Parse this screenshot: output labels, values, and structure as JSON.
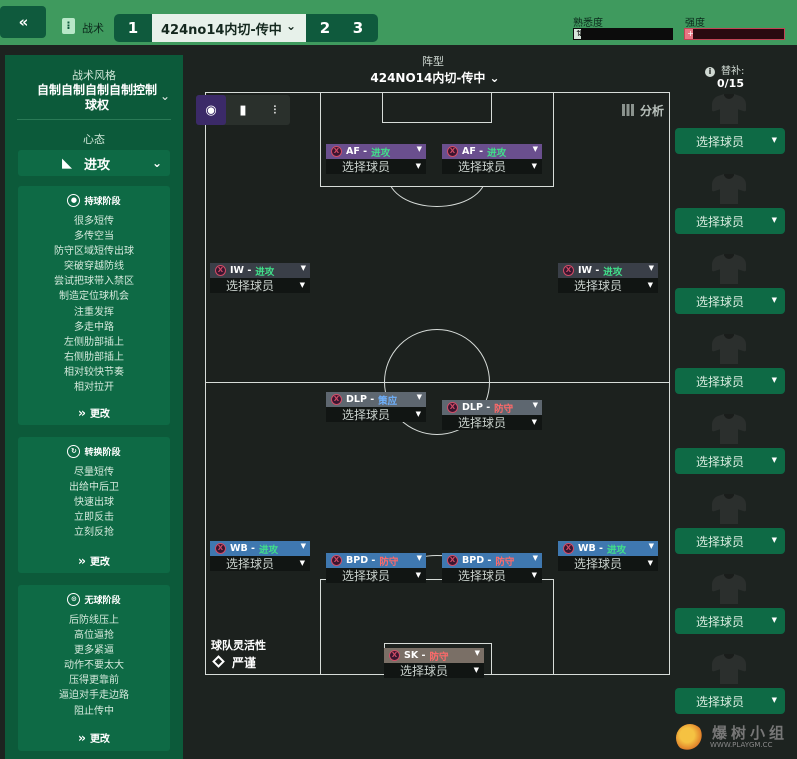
{
  "topbar": {
    "collapse_icon": "«",
    "tab_icon": "tactics-board-icon",
    "tab_label": "战术",
    "slots": [
      "1",
      "2",
      "3"
    ],
    "active_tactic": "424no14内切-传中",
    "familiarity_label": "熟悉度",
    "familiarity_level": 0.07,
    "intensity_label": "强度",
    "intensity_level": 0.08,
    "colors": {
      "bar": "#3f9a5e",
      "dark": "#0f5a3d",
      "intensity_fill": "#e05a6a"
    }
  },
  "left_panel": {
    "style_title": "战术风格",
    "style_value": "自制自制自制自制控制球权",
    "mentality_title": "心态",
    "mentality_value": "进攻",
    "phases": [
      {
        "title": "持球阶段",
        "icon": "ball-icon",
        "items": [
          "很多短传",
          "多传空当",
          "防守区域短传出球",
          "突破穿越防线",
          "尝试把球带入禁区",
          "制造定位球机会",
          "注重发挥",
          "多走中路",
          "左侧肋部插上",
          "右侧肋部插上",
          "相对较快节奏",
          "相对拉开"
        ],
        "change_label": "更改"
      },
      {
        "title": "转换阶段",
        "icon": "transition-icon",
        "items": [
          "尽量短传",
          "出给中后卫",
          "快速出球",
          "立即反击",
          "立刻反抢"
        ],
        "change_label": "更改"
      },
      {
        "title": "无球阶段",
        "icon": "defend-icon",
        "items": [
          "后防线压上",
          "高位逼抢",
          "更多紧逼",
          "动作不要太大",
          "压得更靠前",
          "逼迫对手走边路",
          "阻止传中"
        ],
        "change_label": "更改"
      }
    ]
  },
  "formation": {
    "label": "阵型",
    "name": "424NO14内切-传中",
    "analysis_label": "分析",
    "flexibility_label": "球队灵活性",
    "flexibility_value": "严谨"
  },
  "positions": [
    {
      "role": "AF",
      "duty": "进攻",
      "duty_type": "attack",
      "player": "选择球员",
      "color": "#6a4f8e"
    },
    {
      "role": "AF",
      "duty": "进攻",
      "duty_type": "attack",
      "player": "选择球员",
      "color": "#6a4f8e"
    },
    {
      "role": "IW",
      "duty": "进攻",
      "duty_type": "attack",
      "player": "选择球员",
      "color": "#3a3f48"
    },
    {
      "role": "IW",
      "duty": "进攻",
      "duty_type": "attack",
      "player": "选择球员",
      "color": "#3a3f48"
    },
    {
      "role": "DLP",
      "duty": "策应",
      "duty_type": "support",
      "player": "选择球员",
      "color": "#5e6770"
    },
    {
      "role": "DLP",
      "duty": "防守",
      "duty_type": "defend",
      "player": "选择球员",
      "color": "#5e6770"
    },
    {
      "role": "WB",
      "duty": "进攻",
      "duty_type": "attack",
      "player": "选择球员",
      "color": "#3f78b0"
    },
    {
      "role": "BPD",
      "duty": "防守",
      "duty_type": "defend",
      "player": "选择球员",
      "color": "#3f78b0"
    },
    {
      "role": "BPD",
      "duty": "防守",
      "duty_type": "defend",
      "player": "选择球员",
      "color": "#3f78b0"
    },
    {
      "role": "WB",
      "duty": "进攻",
      "duty_type": "attack",
      "player": "选择球员",
      "color": "#3f78b0"
    },
    {
      "role": "SK",
      "duty": "防守",
      "duty_type": "defend",
      "player": "选择球员",
      "color": "#7a6f66"
    }
  ],
  "subs": {
    "label": "替补:",
    "count": "0/15",
    "slot_label": "选择球员",
    "slots": 8
  },
  "watermark": {
    "main": "爆树小组",
    "sub": "WWW.PLAYGM.CC"
  }
}
